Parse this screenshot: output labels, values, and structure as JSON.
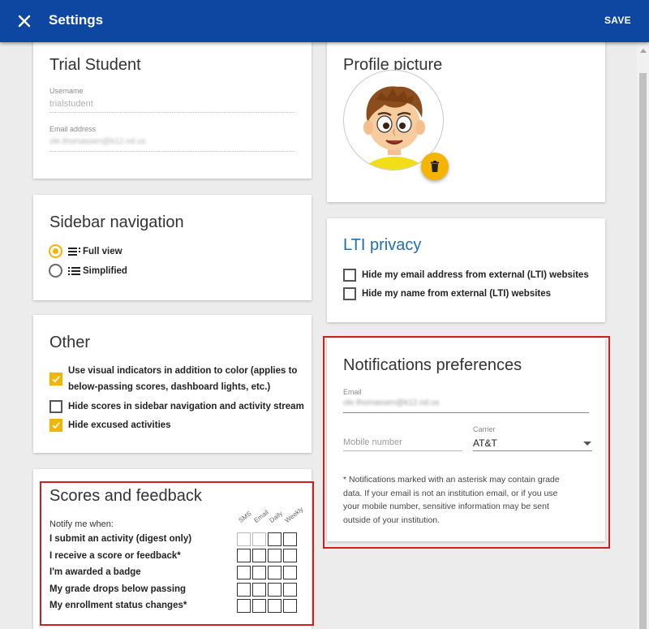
{
  "appbar": {
    "title": "Settings",
    "save_label": "SAVE"
  },
  "account": {
    "name": "Trial Student",
    "username_label": "Username",
    "username_value": "trialstudent",
    "email_label": "Email address",
    "email_value": "ole.thomassen@k12.nd.us"
  },
  "profile": {
    "title": "Profile picture"
  },
  "sidebar_nav": {
    "title": "Sidebar navigation",
    "options": [
      {
        "label": "Full view",
        "selected": true
      },
      {
        "label": "Simplified",
        "selected": false
      }
    ]
  },
  "lti": {
    "title": "LTI privacy",
    "options": [
      {
        "label": "Hide my email address from external (LTI) websites",
        "checked": false
      },
      {
        "label": "Hide my name from external (LTI) websites",
        "checked": false
      }
    ]
  },
  "other": {
    "title": "Other",
    "options": [
      {
        "line1": "Use visual indicators in addition to color (applies to",
        "line2": "below-passing scores, dashboard lights, etc.)",
        "checked": true
      },
      {
        "label": "Hide scores in sidebar navigation and activity stream",
        "checked": false
      },
      {
        "label": "Hide excused activities",
        "checked": true
      }
    ]
  },
  "notifications": {
    "title": "Notifications preferences",
    "email_label": "Email",
    "email_value": "ole.thomassen@k12.nd.us",
    "mobile_placeholder": "Mobile number",
    "carrier_label": "Carrier",
    "carrier_value": "AT&T",
    "note_lines": [
      "* Notifications marked with an asterisk may contain grade",
      "data. If your email is not an institution email, or if you use",
      "your mobile number, sensitive information may be sent",
      "outside of your institution."
    ]
  },
  "scores": {
    "title": "Scores and feedback",
    "notify_label": "Notify me when:",
    "columns": [
      "SMS",
      "Email",
      "Daily",
      "Weekly"
    ],
    "rows": [
      {
        "label": "I submit an activity (digest only)"
      },
      {
        "label": "I receive a score or feedback*"
      },
      {
        "label": "I'm awarded a badge"
      },
      {
        "label": "My grade drops below passing"
      },
      {
        "label": "My enrollment status changes*"
      }
    ]
  },
  "colors": {
    "appbar": "#0d47a1",
    "accent": "#f5b400",
    "highlight": "#d01f1f",
    "lti_title": "#1e6fb0"
  },
  "icons": [
    "close-icon",
    "trash-icon",
    "full-view-icon",
    "simplified-icon",
    "check-icon",
    "chevron-down-icon"
  ]
}
